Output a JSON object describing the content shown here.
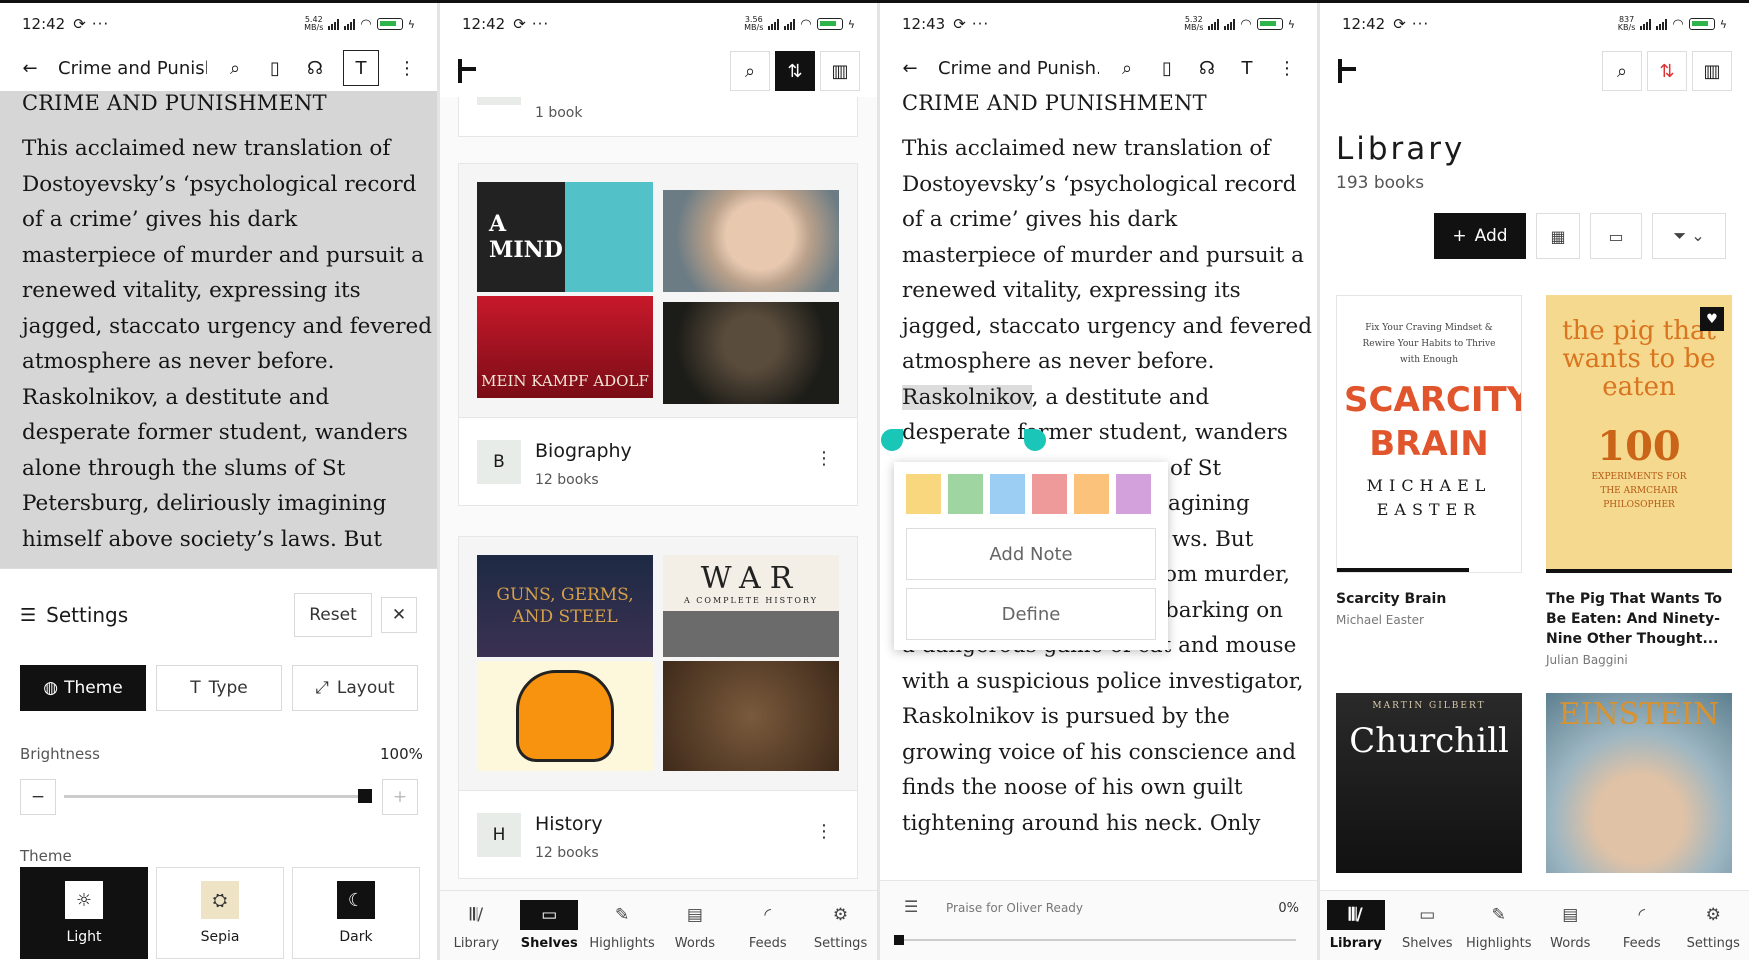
{
  "status": [
    {
      "time": "12:42",
      "speed": "5.42",
      "unit": "MB/s",
      "battery": "65"
    },
    {
      "time": "12:42",
      "speed": "3.56",
      "unit": "MB/s",
      "battery": "65"
    },
    {
      "time": "12:43",
      "speed": "5.32",
      "unit": "MB/s",
      "battery": "65"
    },
    {
      "time": "12:42",
      "speed": "837",
      "unit": "KB/s",
      "battery": "65"
    }
  ],
  "reader": {
    "book_title": "Crime and Punish...",
    "chapter_heading": "CRIME AND PUNISHMENT",
    "lines": [
      "This acclaimed new translation of",
      "Dostoyevsky’s ‘psychological record",
      "of a crime’ gives his dark",
      "masterpiece of murder and pursuit a",
      "renewed vitality, expressing its",
      "jagged, staccato urgency and fevered",
      "atmosphere as never before.",
      "Raskolnikov, a destitute and",
      "desperate former student, wanders",
      "alone through the slums of St",
      "Petersburg, deliriously imagining",
      "himself above society’s laws. But"
    ],
    "lines_p3": [
      "This acclaimed new translation of",
      "Dostoyevsky’s ‘psychological record",
      "of a crime’ gives his dark",
      "masterpiece of murder and pursuit a",
      "renewed vitality, expressing its",
      "jagged, staccato urgency and fevered",
      "atmosphere as never before."
    ],
    "selected_word": "Raskolnikov",
    "after_selected": ", a destitute and",
    "line9": "desperate former student, wanders",
    "partial": [
      "of St",
      "agining",
      "ws. But",
      "om murder,",
      "barking on"
    ],
    "line_danger": "a dangerous game of cat and mouse",
    "lines_tail": [
      "with a suspicious police investigator,",
      "Raskolnikov is pursued by the",
      "growing voice of his conscience and",
      "finds the noose of his own guilt",
      "tightening around his neck. Only"
    ],
    "footer_chapter": "Praise for Oliver Ready",
    "footer_progress": "0%"
  },
  "popup": {
    "colors": [
      "#f9d77e",
      "#9fd5a0",
      "#9ccdf2",
      "#ee9a9a",
      "#fbc27b",
      "#d3a1dc"
    ],
    "add_note": "Add Note",
    "define": "Define"
  },
  "settings": {
    "title": "Settings",
    "reset": "Reset",
    "tabs": [
      "Theme",
      "Type",
      "Layout"
    ],
    "brightness_label": "Brightness",
    "brightness_value": "100%",
    "theme_label": "Theme",
    "themes": [
      "Light",
      "Sepia",
      "Dark"
    ]
  },
  "shelves": {
    "prev_count": "1 book",
    "items": [
      {
        "badge": "B",
        "name": "Biography",
        "count": "12 books"
      },
      {
        "badge": "H",
        "name": "History",
        "count": "12 books"
      }
    ],
    "covers_bio": [
      "A MIND",
      "MEIN KAMPF ADOLF"
    ],
    "covers_hist": [
      "GUNS, GERMS, AND STEEL",
      "WAR",
      "A COMPLETE HISTORY"
    ]
  },
  "library": {
    "title": "Library",
    "count": "193 books",
    "add": "Add",
    "books": [
      {
        "title": "Scarcity Brain",
        "author": "Michael Easter"
      },
      {
        "title": "The Pig That Wants To Be Eaten: And Ninety-Nine Other Thought...",
        "author": "Julian Baggini"
      }
    ],
    "cover_text": {
      "scarcity_top": "Fix Your Craving Mindset & Rewire Your Habits to Thrive with Enough",
      "scarcity_main": "SCARCITY BRAIN",
      "scarcity_author": "MICHAEL EASTER",
      "pig_main": "the pig that wants to be eaten",
      "pig_num": "100",
      "pig_sub": "EXPERIMENTS FOR THE ARMCHAIR PHILOSOPHER",
      "churchill_author": "MARTIN GILBERT",
      "churchill_title": "Churchill",
      "einstein_title": "EINSTEIN"
    }
  },
  "nav": [
    "Library",
    "Shelves",
    "Highlights",
    "Words",
    "Feeds",
    "Settings"
  ]
}
